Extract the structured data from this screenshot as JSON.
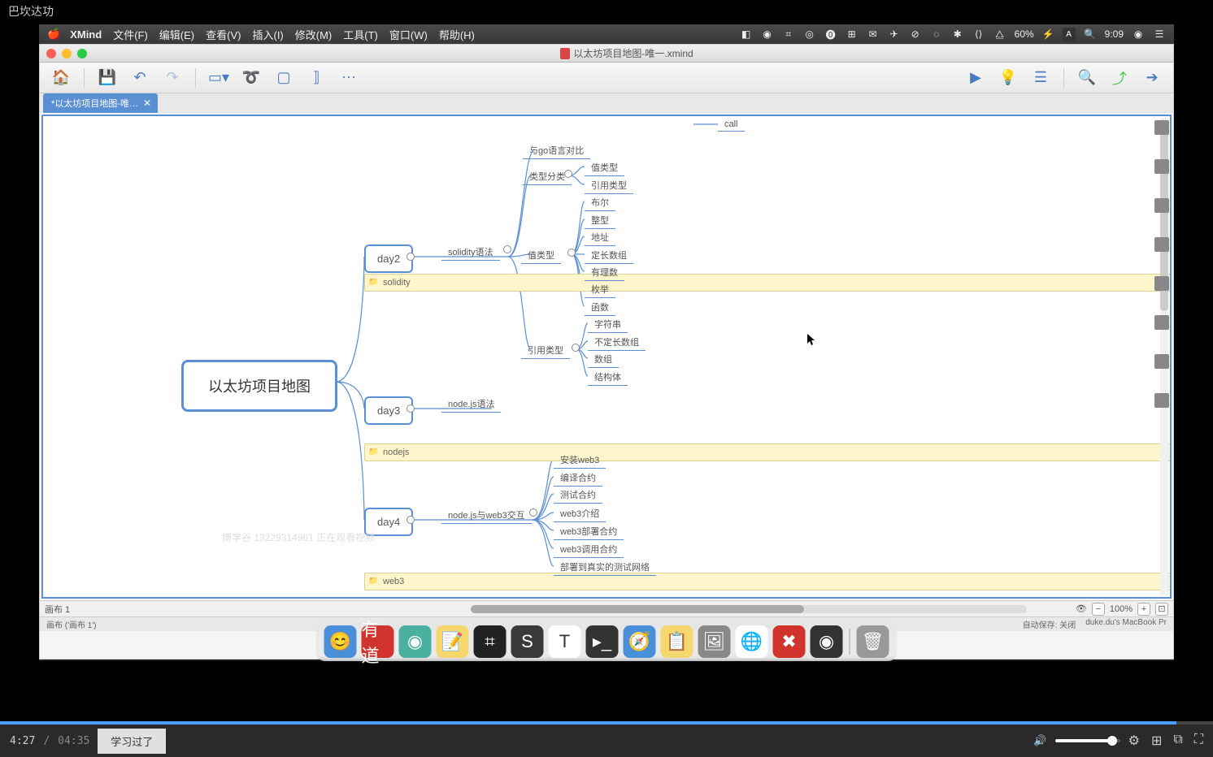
{
  "topBlack": "巴坎达功",
  "menubar": {
    "appName": "XMind",
    "items": [
      "文件(F)",
      "编辑(E)",
      "查看(V)",
      "插入(I)",
      "修改(M)",
      "工具(T)",
      "窗口(W)",
      "帮助(H)"
    ],
    "battery": "60%",
    "time": "9:09"
  },
  "window": {
    "title": "以太坊项目地图-唯一.xmind",
    "tabName": "*以太坊项目地图-唯…"
  },
  "mindmap": {
    "central": "以太坊项目地图",
    "topRight": "call",
    "day2": {
      "label": "day2",
      "tag": "solidity",
      "branch": "solidity语法",
      "sub1": "与go语言对比",
      "typeClassLabel": "类型分类",
      "typeClass": [
        "值类型",
        "引用类型"
      ],
      "valueTypeLabel": "值类型",
      "valueType": [
        "布尔",
        "整型",
        "地址",
        "定长数组",
        "有理数",
        "枚举",
        "函数"
      ],
      "refTypeLabel": "引用类型",
      "refType": [
        "字符串",
        "不定长数组",
        "数组",
        "结构体"
      ]
    },
    "day3": {
      "label": "day3",
      "tag": "nodejs",
      "branch": "node.js语法"
    },
    "day4": {
      "label": "day4",
      "tag": "web3",
      "branch": "node.js与web3交互",
      "items": [
        "安装web3",
        "编译合约",
        "测试合约",
        "web3介绍",
        "web3部署合约",
        "web3调用合约",
        "部署到真实的测试网络"
      ]
    },
    "watermark": "博学谷 13229314961 正在观看视频"
  },
  "sheetBar": {
    "label": "画布 1",
    "zoom": "100%"
  },
  "statusBar": {
    "left": "画布 ('画布 1')",
    "autosave": "自动保存: 关闭",
    "machine": "duke.du's MacBook Pr"
  },
  "video": {
    "currentTime": "4:27",
    "duration": "04:35",
    "learnedBtn": "学习过了"
  }
}
